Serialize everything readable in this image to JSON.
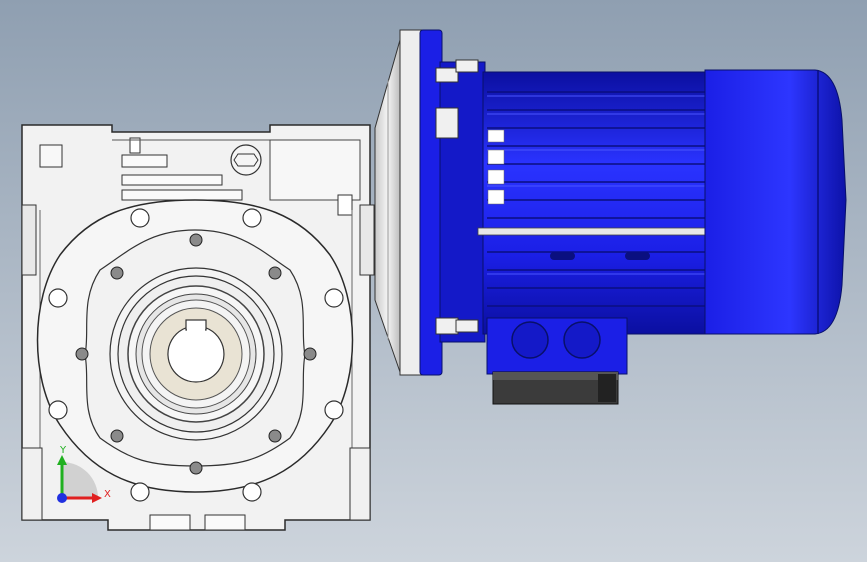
{
  "viewport": {
    "background_top": "#8f9fb1",
    "background_bottom": "#cdd4dc"
  },
  "model": {
    "motor_color": "#1b1fe6",
    "motor_dark": "#0b0fa0",
    "motor_light": "#4a55ff",
    "housing_color": "#f2f2f2",
    "housing_edge": "#2a2a2a",
    "bore_color": "#e9e3d4",
    "terminal_box_color": "#3b3b3b"
  },
  "triad": {
    "x_label": "X",
    "y_label": "Y",
    "x_color": "#e02020",
    "y_color": "#20b020",
    "z_color": "#2030e0"
  }
}
